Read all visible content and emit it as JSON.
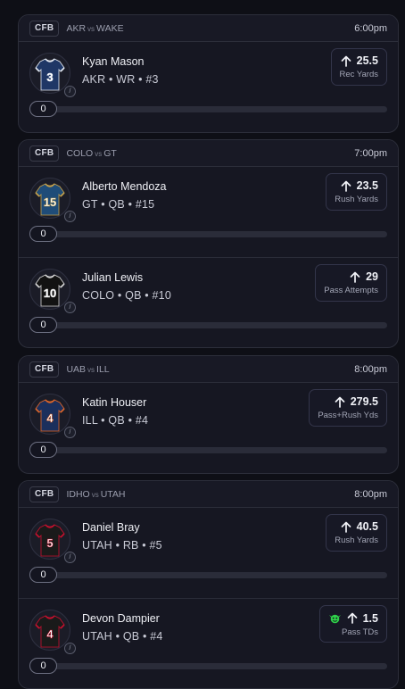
{
  "cards": [
    {
      "league": "CFB",
      "team1": "AKR",
      "vs": "vs",
      "team2": "WAKE",
      "time": "6:00pm",
      "rows": [
        {
          "name": "Kyan Mason",
          "info": "AKR • WR • #3",
          "jersey_number": "3",
          "jersey_color": "#1f3766",
          "trim_color": "#e8edf5",
          "direction": "up",
          "value": "25.5",
          "label": "Rec Yards",
          "goblin": false,
          "progress": "0",
          "progress_fraction": 0
        }
      ]
    },
    {
      "league": "CFB",
      "team1": "COLO",
      "vs": "vs",
      "team2": "GT",
      "time": "7:00pm",
      "rows": [
        {
          "name": "Alberto Mendoza",
          "info": "GT • QB • #15",
          "jersey_number": "15",
          "jersey_color": "#1f4c78",
          "trim_color": "#c9a24a",
          "direction": "up",
          "value": "23.5",
          "label": "Rush Yards",
          "goblin": false,
          "progress": "0",
          "progress_fraction": 0
        },
        {
          "name": "Julian Lewis",
          "info": "COLO • QB • #10",
          "jersey_number": "10",
          "jersey_color": "#121212",
          "trim_color": "#d8d8d8",
          "direction": "up",
          "value": "29",
          "label": "Pass Attempts",
          "goblin": false,
          "progress": "0",
          "progress_fraction": 0
        }
      ]
    },
    {
      "league": "CFB",
      "team1": "UAB",
      "vs": "vs",
      "team2": "ILL",
      "time": "8:00pm",
      "rows": [
        {
          "name": "Katin Houser",
          "info": "ILL • QB • #4",
          "jersey_number": "4",
          "jersey_color": "#1b2f5c",
          "trim_color": "#e2672a",
          "direction": "up",
          "value": "279.5",
          "label": "Pass+Rush Yds",
          "goblin": false,
          "progress": "0",
          "progress_fraction": 0
        }
      ]
    },
    {
      "league": "CFB",
      "team1": "IDHO",
      "vs": "vs",
      "team2": "UTAH",
      "time": "8:00pm",
      "rows": [
        {
          "name": "Daniel Bray",
          "info": "UTAH • RB • #5",
          "jersey_number": "5",
          "jersey_color": "#1a1a1a",
          "trim_color": "#c8102e",
          "direction": "up",
          "value": "40.5",
          "label": "Rush Yards",
          "goblin": false,
          "progress": "0",
          "progress_fraction": 0
        },
        {
          "name": "Devon Dampier",
          "info": "UTAH • QB • #4",
          "jersey_number": "4",
          "jersey_color": "#1a1a1a",
          "trim_color": "#c8102e",
          "direction": "up",
          "value": "1.5",
          "label": "Pass TDs",
          "goblin": true,
          "progress": "0",
          "progress_fraction": 0
        }
      ]
    }
  ],
  "colors": {
    "goblin": "#2fcf4a",
    "fill": "#6c6f84"
  },
  "icons": {
    "arrow": "arrow-up-icon",
    "goblin": "goblin-icon",
    "badge": "player-badge-icon"
  }
}
